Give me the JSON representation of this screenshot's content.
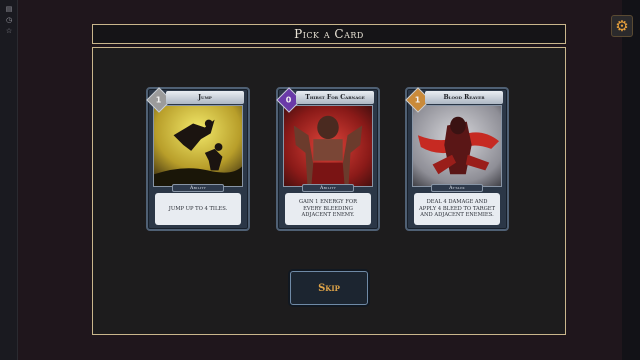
{
  "title": "Pick a Card",
  "settings_icon": "gear-icon",
  "left_strip_icons": [
    "file-icon",
    "clock-icon",
    "star-icon"
  ],
  "cards": [
    {
      "name": "Jump",
      "cost": "1",
      "type": "Ability",
      "description": "Jump up to 4 tiles.",
      "gem_color": "#9b9b9b",
      "art_colors": [
        "#e2d545",
        "#b79a2b",
        "#2c2410"
      ]
    },
    {
      "name": "Thirst For Carnage",
      "cost": "0",
      "type": "Ability",
      "description": "Gain 1 Energy for every bleeding adjacent enemy.",
      "gem_color": "#6a3aa8",
      "art_colors": [
        "#8a1a18",
        "#d9352c",
        "#2a0b0b"
      ]
    },
    {
      "name": "Blood Reaver",
      "cost": "1",
      "type": "Attack",
      "description": "Deal 4 damage and apply 4 Bleed to target and adjacent enemies.",
      "gem_color": "#c98a3a",
      "art_colors": [
        "#b8b8bd",
        "#c62a22",
        "#3a1414"
      ]
    }
  ],
  "skip_label": "Skip",
  "colors": {
    "accent_border": "#c9b68c",
    "skip_text": "#e0a549",
    "settings_icon": "#e9a13c"
  }
}
